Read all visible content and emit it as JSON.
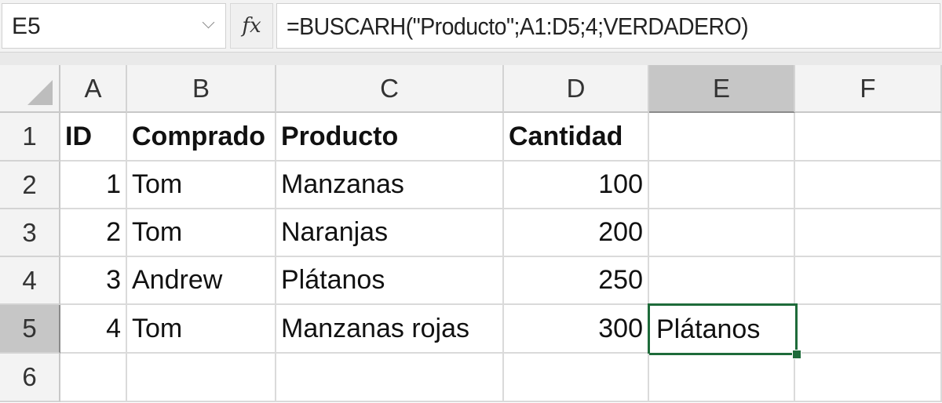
{
  "formula_bar": {
    "name_box": "E5",
    "fx_label": "fx",
    "formula": "=BUSCARH(\"Producto\";A1:D5;4;VERDADERO)"
  },
  "columns": [
    "A",
    "B",
    "C",
    "D",
    "E",
    "F"
  ],
  "rows": [
    "1",
    "2",
    "3",
    "4",
    "5",
    "6"
  ],
  "selection": {
    "column": "E",
    "row": "5",
    "accent_color": "#1e6b3a"
  },
  "cells": {
    "A1": "ID",
    "B1": "Comprado",
    "C1": "Producto",
    "D1": "Cantidad",
    "A2": "1",
    "B2": "Tom",
    "C2": "Manzanas",
    "D2": "100",
    "A3": "2",
    "B3": "Tom",
    "C3": "Naranjas",
    "D3": "200",
    "A4": "3",
    "B4": "Andrew",
    "C4": "Plátanos",
    "D4": "250",
    "A5": "4",
    "B5": "Tom",
    "C5": "Manzanas rojas",
    "D5": "300",
    "E5": "Plátanos"
  }
}
